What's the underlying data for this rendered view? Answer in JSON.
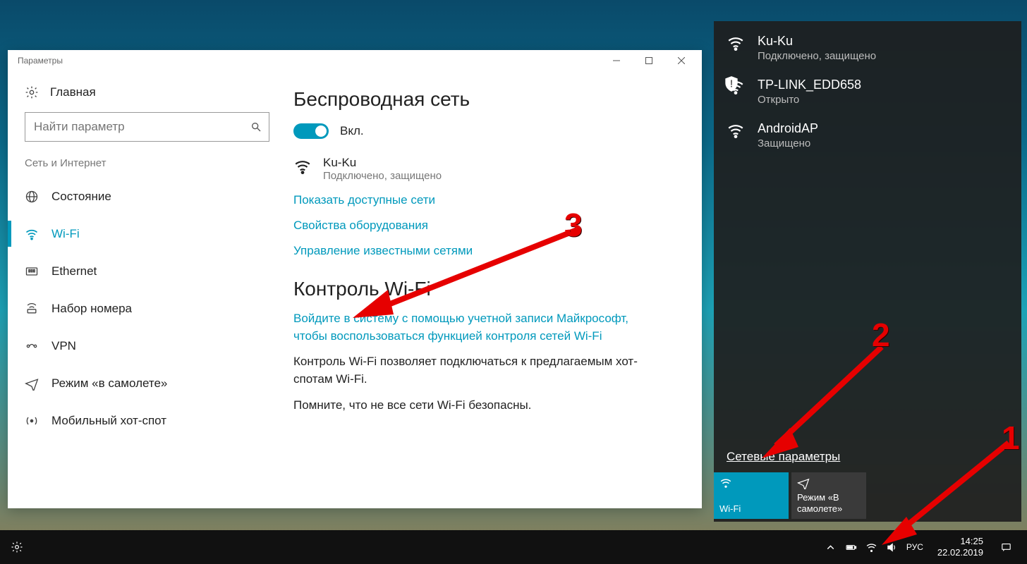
{
  "settings": {
    "title": "Параметры",
    "home": "Главная",
    "search_placeholder": "Найти параметр",
    "section": "Сеть и Интернет",
    "nav": {
      "status": "Состояние",
      "wifi": "Wi-Fi",
      "ethernet": "Ethernet",
      "dialup": "Набор номера",
      "vpn": "VPN",
      "airplane": "Режим «в самолете»",
      "hotspot": "Мобильный хот-спот"
    },
    "content": {
      "heading": "Беспроводная сеть",
      "toggle_label": "Вкл.",
      "net_name": "Ku-Ku",
      "net_sub": "Подключено, защищено",
      "link_show": "Показать доступные сети",
      "link_hw": "Свойства оборудования",
      "link_known": "Управление известными сетями",
      "heading2": "Контроль Wi-Fi",
      "signin": "Войдите в систему с помощью учетной записи Майкрософт, чтобы воспользоваться функцией контроля сетей Wi-Fi",
      "p1": "Контроль Wi-Fi позволяет подключаться к предлагаемым хот-спотам Wi-Fi.",
      "p2": "Помните, что не все сети Wi-Fi безопасны."
    }
  },
  "flyout": {
    "nets": [
      {
        "name": "Ku-Ku",
        "sub": "Подключено, защищено",
        "shield": false
      },
      {
        "name": "TP-LINK_EDD658",
        "sub": "Открыто",
        "shield": true
      },
      {
        "name": "AndroidAP",
        "sub": "Защищено",
        "shield": false
      }
    ],
    "link": "Сетевые параметры",
    "tile_wifi": "Wi-Fi",
    "tile_plane": "Режим «В самолете»"
  },
  "taskbar": {
    "lang": "РУС",
    "time": "14:25",
    "date": "22.02.2019"
  },
  "annotations": {
    "n1": "1",
    "n2": "2",
    "n3": "3"
  }
}
